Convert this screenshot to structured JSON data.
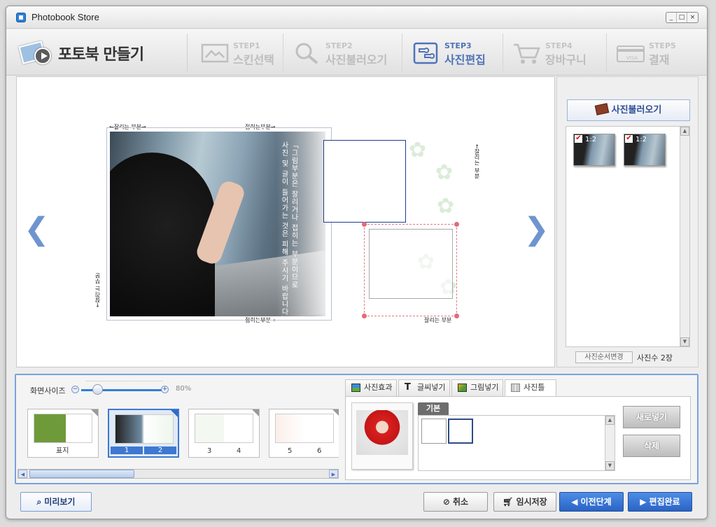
{
  "window": {
    "title": "Photobook Store",
    "controls": [
      "_",
      "□",
      "×"
    ]
  },
  "brand": {
    "title": "포토북 만들기"
  },
  "steps": [
    {
      "num": "STEP1",
      "name": "스킨선택",
      "icon": "skin-icon",
      "active": false
    },
    {
      "num": "STEP2",
      "name": "사진불러오기",
      "icon": "magnifier-icon",
      "active": false
    },
    {
      "num": "STEP3",
      "name": "사진편집",
      "icon": "puzzle-edit-icon",
      "active": true
    },
    {
      "num": "STEP4",
      "name": "장바구니",
      "icon": "cart-icon",
      "active": false
    },
    {
      "num": "STEP5",
      "name": "결재",
      "icon": "card-icon",
      "active": false
    }
  ],
  "canvas": {
    "prev_arrow": "❮",
    "next_arrow": "❯",
    "cut_top_left": "←잘리는 부분→",
    "cut_top_mid": "접히는부분→",
    "cut_bottom_mid": "접히는부분→",
    "cut_bottom_right": "잘리는 부분",
    "cut_side_left": "←잘리는 부분",
    "cut_side_right": "←잘리는 부분",
    "notice_line1": "「그림부분은 잘리거나 접히는 부분이므로",
    "notice_line2": "사진 및 글이 들어가는 것은 피해 주시기 바랍니다」"
  },
  "right_panel": {
    "load_button": "사진불러오기",
    "photos": [
      {
        "count": "1:2"
      },
      {
        "count": "1:2"
      }
    ],
    "reorder_button": "사진순서변경",
    "photo_count": "사진수 2장"
  },
  "zoom": {
    "label": "화면사이즈",
    "minus": "−",
    "plus": "+",
    "value": "80%",
    "level": 0.2
  },
  "pages": [
    {
      "label_left": "표지",
      "label_right": "",
      "selected": false
    },
    {
      "label_left": "1",
      "label_right": "2",
      "selected": true
    },
    {
      "label_left": "3",
      "label_right": "4",
      "selected": false
    },
    {
      "label_left": "5",
      "label_right": "6",
      "selected": false
    }
  ],
  "tabs": [
    {
      "label": "사진효과",
      "icon": "photo-effect-icon",
      "active": false
    },
    {
      "label": "글씨넣기",
      "icon": "text-t-icon",
      "active": false
    },
    {
      "label": "그림넣기",
      "icon": "image-insert-icon",
      "active": false
    },
    {
      "label": "사진틀",
      "icon": "frame-icon",
      "active": true
    }
  ],
  "frames": {
    "group_label": "기본",
    "new_button": "새로넣기",
    "delete_button": "삭제"
  },
  "footer": {
    "preview_button": "미리보기",
    "cancel_button": "취소",
    "save_button": "임시저장",
    "prev_button": "이전단계",
    "done_button": "편집완료"
  }
}
